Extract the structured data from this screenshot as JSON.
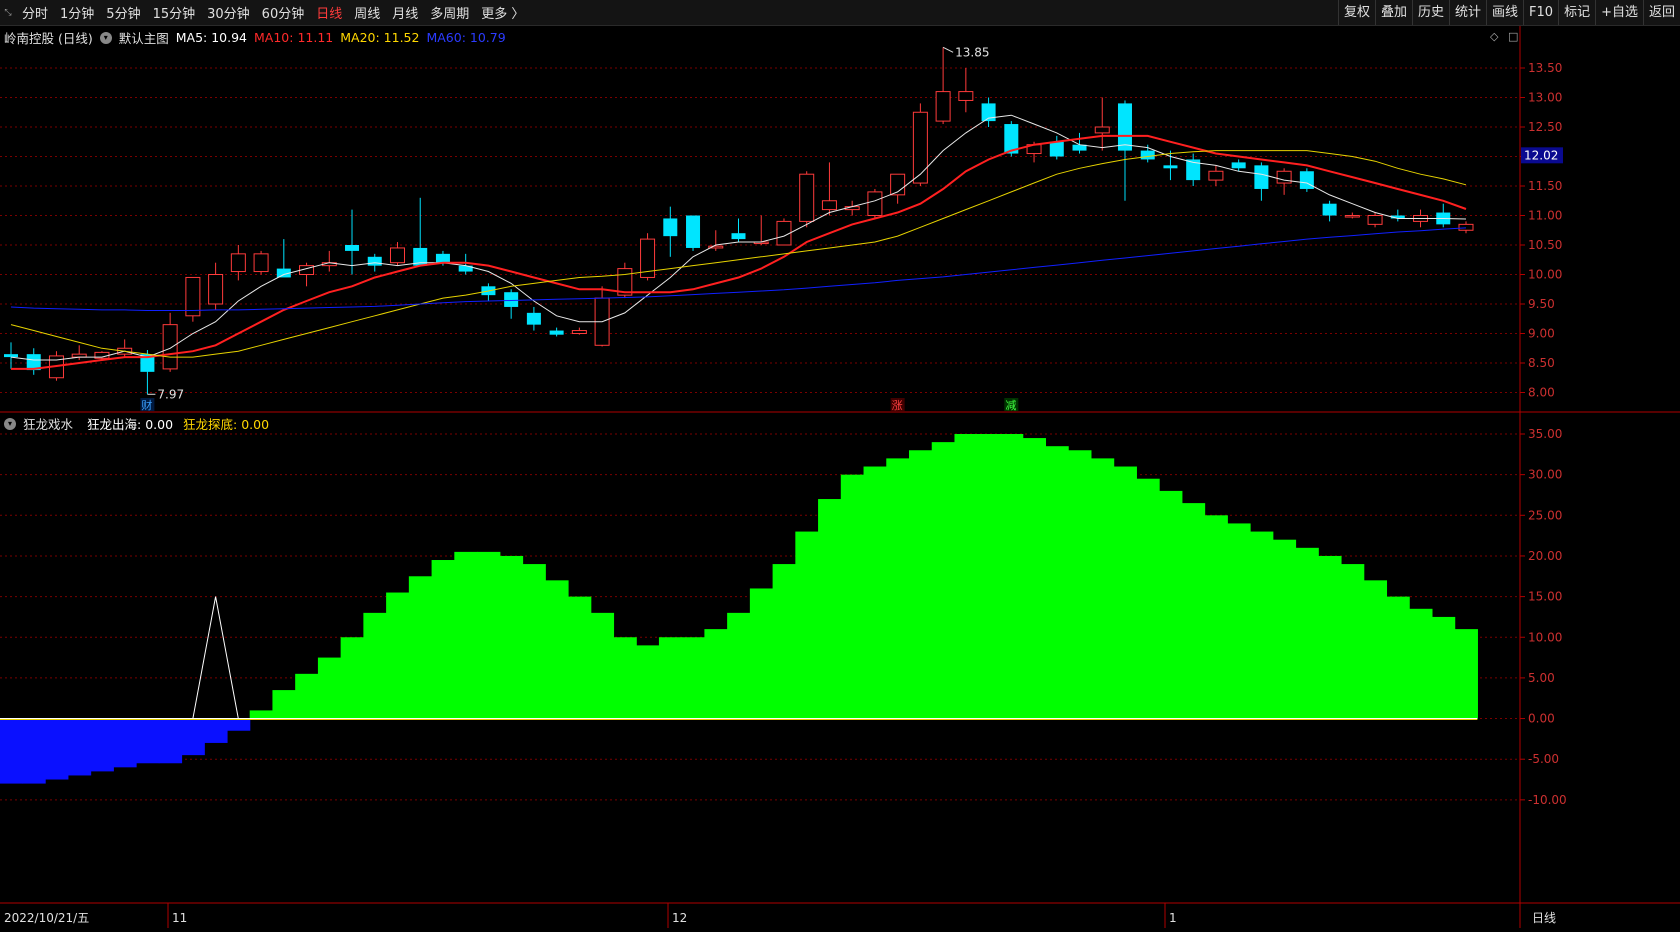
{
  "toolbar": {
    "periods": [
      {
        "label": "分时"
      },
      {
        "label": "1分钟"
      },
      {
        "label": "5分钟"
      },
      {
        "label": "15分钟"
      },
      {
        "label": "30分钟"
      },
      {
        "label": "60分钟"
      },
      {
        "label": "日线",
        "active": true
      },
      {
        "label": "周线"
      },
      {
        "label": "月线"
      },
      {
        "label": "多周期"
      },
      {
        "label": "更多 〉"
      }
    ],
    "actions": [
      "复权",
      "叠加",
      "历史",
      "统计",
      "画线",
      "F10",
      "标记",
      "+自选",
      "返回"
    ]
  },
  "main": {
    "stock_title": "岭南控股 (日线)",
    "template": "默认主图",
    "ma": [
      {
        "label": "MA5: 10.94",
        "color": "#ffffff"
      },
      {
        "label": "MA10: 11.11",
        "color": "#ff2a2a"
      },
      {
        "label": "MA20: 11.52",
        "color": "#ffd700"
      },
      {
        "label": "MA60: 10.79",
        "color": "#2b3bff"
      }
    ],
    "price_ticks": [
      "13.50",
      "13.00",
      "12.50",
      "12.00",
      "11.50",
      "11.00",
      "10.50",
      "10.00",
      "9.50",
      "9.00",
      "8.50",
      "8.00"
    ],
    "current_price": "12.02",
    "high_label": "13.85",
    "low_label": "7.97",
    "markers": [
      {
        "label": "财",
        "color": "#3aa0ff",
        "bg": "#001a40"
      },
      {
        "label": "涨",
        "color": "#ff4040",
        "bg": "#400000"
      },
      {
        "label": "减",
        "color": "#40ff40",
        "bg": "#003300"
      }
    ]
  },
  "indicator": {
    "name": "狂龙戏水",
    "items": [
      {
        "label": "狂龙出海: 0.00",
        "color": "#ffffff"
      },
      {
        "label": "狂龙探底: 0.00",
        "color": "#ffd700"
      }
    ],
    "ticks": [
      "35.00",
      "30.00",
      "25.00",
      "20.00",
      "15.00",
      "10.00",
      "5.00",
      "0.00",
      "-5.00",
      "-10.00"
    ]
  },
  "bottom_axis": {
    "date_label": "2022/10/21/五",
    "months": [
      "11",
      "12",
      "1"
    ],
    "period_label": "日线"
  },
  "colors": {
    "up": "#ff3b3b",
    "down": "#00e5ff",
    "green": "#00ff00",
    "blue": "#0a10ff",
    "grid": "#7a0000"
  },
  "chart_data": {
    "type": "candlestick",
    "candles": [
      {
        "o": 8.65,
        "h": 8.85,
        "l": 8.4,
        "c": 8.6
      },
      {
        "o": 8.65,
        "h": 8.75,
        "l": 8.3,
        "c": 8.38
      },
      {
        "o": 8.25,
        "h": 8.7,
        "l": 8.2,
        "c": 8.62
      },
      {
        "o": 8.6,
        "h": 8.8,
        "l": 8.55,
        "c": 8.65
      },
      {
        "o": 8.58,
        "h": 8.7,
        "l": 8.55,
        "c": 8.68
      },
      {
        "o": 8.65,
        "h": 8.9,
        "l": 8.6,
        "c": 8.75
      },
      {
        "o": 8.65,
        "h": 8.72,
        "l": 7.97,
        "c": 8.35
      },
      {
        "o": 8.4,
        "h": 9.35,
        "l": 8.35,
        "c": 9.15
      },
      {
        "o": 9.3,
        "h": 9.95,
        "l": 9.2,
        "c": 9.95
      },
      {
        "o": 9.5,
        "h": 10.2,
        "l": 9.4,
        "c": 10.0
      },
      {
        "o": 10.05,
        "h": 10.5,
        "l": 9.9,
        "c": 10.35
      },
      {
        "o": 10.05,
        "h": 10.4,
        "l": 10.0,
        "c": 10.35
      },
      {
        "o": 10.1,
        "h": 10.6,
        "l": 10.0,
        "c": 9.95
      },
      {
        "o": 10.0,
        "h": 10.2,
        "l": 9.8,
        "c": 10.15
      },
      {
        "o": 10.15,
        "h": 10.4,
        "l": 10.05,
        "c": 10.2
      },
      {
        "o": 10.5,
        "h": 11.1,
        "l": 10.0,
        "c": 10.4
      },
      {
        "o": 10.3,
        "h": 10.35,
        "l": 10.05,
        "c": 10.15
      },
      {
        "o": 10.2,
        "h": 10.55,
        "l": 10.15,
        "c": 10.45
      },
      {
        "o": 10.45,
        "h": 11.3,
        "l": 10.25,
        "c": 10.15
      },
      {
        "o": 10.35,
        "h": 10.4,
        "l": 10.15,
        "c": 10.2
      },
      {
        "o": 10.15,
        "h": 10.35,
        "l": 10.0,
        "c": 10.05
      },
      {
        "o": 9.8,
        "h": 9.85,
        "l": 9.55,
        "c": 9.65
      },
      {
        "o": 9.7,
        "h": 9.75,
        "l": 9.25,
        "c": 9.45
      },
      {
        "o": 9.35,
        "h": 9.45,
        "l": 9.05,
        "c": 9.15
      },
      {
        "o": 9.05,
        "h": 9.1,
        "l": 8.95,
        "c": 8.98
      },
      {
        "o": 9.0,
        "h": 9.1,
        "l": 8.98,
        "c": 9.05
      },
      {
        "o": 8.8,
        "h": 9.8,
        "l": 8.78,
        "c": 9.6
      },
      {
        "o": 9.65,
        "h": 10.2,
        "l": 9.6,
        "c": 10.1
      },
      {
        "o": 9.95,
        "h": 10.7,
        "l": 9.9,
        "c": 10.6
      },
      {
        "o": 10.95,
        "h": 11.15,
        "l": 10.3,
        "c": 10.65
      },
      {
        "o": 11.0,
        "h": 11.0,
        "l": 10.4,
        "c": 10.45
      },
      {
        "o": 10.45,
        "h": 10.75,
        "l": 10.4,
        "c": 10.48
      },
      {
        "o": 10.7,
        "h": 10.95,
        "l": 10.55,
        "c": 10.6
      },
      {
        "o": 10.55,
        "h": 11.0,
        "l": 10.5,
        "c": 10.55
      },
      {
        "o": 10.5,
        "h": 10.95,
        "l": 10.5,
        "c": 10.9
      },
      {
        "o": 10.9,
        "h": 11.75,
        "l": 10.8,
        "c": 11.7
      },
      {
        "o": 11.1,
        "h": 11.9,
        "l": 11.0,
        "c": 11.25
      },
      {
        "o": 11.1,
        "h": 11.25,
        "l": 11.0,
        "c": 11.15
      },
      {
        "o": 11.0,
        "h": 11.45,
        "l": 10.95,
        "c": 11.4
      },
      {
        "o": 11.35,
        "h": 11.6,
        "l": 11.2,
        "c": 11.7
      },
      {
        "o": 11.55,
        "h": 12.9,
        "l": 11.5,
        "c": 12.75
      },
      {
        "o": 12.6,
        "h": 13.85,
        "l": 12.55,
        "c": 13.1
      },
      {
        "o": 12.95,
        "h": 13.5,
        "l": 12.75,
        "c": 13.1
      },
      {
        "o": 12.9,
        "h": 13.0,
        "l": 12.5,
        "c": 12.6
      },
      {
        "o": 12.55,
        "h": 12.6,
        "l": 12.0,
        "c": 12.05
      },
      {
        "o": 12.05,
        "h": 12.25,
        "l": 11.9,
        "c": 12.2
      },
      {
        "o": 12.25,
        "h": 12.35,
        "l": 11.95,
        "c": 12.0
      },
      {
        "o": 12.2,
        "h": 12.4,
        "l": 12.05,
        "c": 12.1
      },
      {
        "o": 12.4,
        "h": 13.0,
        "l": 12.1,
        "c": 12.5
      },
      {
        "o": 12.9,
        "h": 12.95,
        "l": 11.25,
        "c": 12.1
      },
      {
        "o": 12.1,
        "h": 12.2,
        "l": 11.9,
        "c": 11.95
      },
      {
        "o": 11.85,
        "h": 12.1,
        "l": 11.6,
        "c": 11.8
      },
      {
        "o": 11.95,
        "h": 12.05,
        "l": 11.5,
        "c": 11.6
      },
      {
        "o": 11.6,
        "h": 11.85,
        "l": 11.5,
        "c": 11.75
      },
      {
        "o": 11.9,
        "h": 11.95,
        "l": 11.75,
        "c": 11.8
      },
      {
        "o": 11.85,
        "h": 11.9,
        "l": 11.25,
        "c": 11.45
      },
      {
        "o": 11.55,
        "h": 11.8,
        "l": 11.35,
        "c": 11.75
      },
      {
        "o": 11.75,
        "h": 11.8,
        "l": 11.4,
        "c": 11.45
      },
      {
        "o": 11.2,
        "h": 11.25,
        "l": 10.9,
        "c": 11.0
      },
      {
        "o": 11.0,
        "h": 11.05,
        "l": 10.95,
        "c": 11.0
      },
      {
        "o": 10.85,
        "h": 11.05,
        "l": 10.8,
        "c": 11.0
      },
      {
        "o": 11.0,
        "h": 11.1,
        "l": 10.9,
        "c": 10.95
      },
      {
        "o": 10.9,
        "h": 11.1,
        "l": 10.8,
        "c": 11.0
      },
      {
        "o": 11.05,
        "h": 11.2,
        "l": 10.8,
        "c": 10.85
      },
      {
        "o": 10.75,
        "h": 10.9,
        "l": 10.7,
        "c": 10.85
      }
    ],
    "ma_series": {
      "MA5": [
        8.6,
        8.55,
        8.55,
        8.6,
        8.6,
        8.7,
        8.6,
        8.75,
        9.0,
        9.2,
        9.55,
        9.8,
        10.0,
        10.1,
        10.2,
        10.15,
        10.2,
        10.15,
        10.2,
        10.2,
        10.15,
        10.05,
        9.85,
        9.55,
        9.3,
        9.2,
        9.2,
        9.35,
        9.65,
        9.95,
        10.3,
        10.5,
        10.55,
        10.55,
        10.65,
        10.85,
        11.05,
        11.15,
        11.25,
        11.4,
        11.7,
        12.1,
        12.4,
        12.65,
        12.7,
        12.55,
        12.4,
        12.2,
        12.15,
        12.2,
        12.15,
        12.0,
        11.9,
        11.85,
        11.75,
        11.7,
        11.6,
        11.55,
        11.35,
        11.2,
        11.05,
        10.95,
        10.95,
        10.95,
        10.94
      ],
      "MA10": [
        8.4,
        8.4,
        8.45,
        8.5,
        8.55,
        8.6,
        8.6,
        8.65,
        8.7,
        8.8,
        9.0,
        9.2,
        9.4,
        9.55,
        9.7,
        9.8,
        9.95,
        10.05,
        10.15,
        10.2,
        10.2,
        10.15,
        10.05,
        9.95,
        9.85,
        9.75,
        9.75,
        9.7,
        9.7,
        9.7,
        9.75,
        9.85,
        9.95,
        10.1,
        10.3,
        10.55,
        10.7,
        10.85,
        10.95,
        11.05,
        11.2,
        11.45,
        11.75,
        11.95,
        12.1,
        12.2,
        12.25,
        12.3,
        12.35,
        12.35,
        12.35,
        12.25,
        12.15,
        12.05,
        12.0,
        11.95,
        11.9,
        11.85,
        11.75,
        11.65,
        11.55,
        11.45,
        11.35,
        11.25,
        11.11
      ],
      "MA20": [
        9.15,
        9.05,
        8.95,
        8.85,
        8.75,
        8.7,
        8.65,
        8.6,
        8.6,
        8.65,
        8.7,
        8.8,
        8.9,
        9.0,
        9.1,
        9.2,
        9.3,
        9.4,
        9.5,
        9.6,
        9.65,
        9.72,
        9.8,
        9.85,
        9.9,
        9.95,
        9.97,
        10.0,
        10.05,
        10.1,
        10.15,
        10.2,
        10.25,
        10.3,
        10.35,
        10.4,
        10.45,
        10.5,
        10.55,
        10.65,
        10.8,
        10.95,
        11.1,
        11.25,
        11.4,
        11.55,
        11.7,
        11.8,
        11.88,
        11.95,
        12.0,
        12.05,
        12.08,
        12.1,
        12.1,
        12.1,
        12.1,
        12.1,
        12.05,
        12.0,
        11.92,
        11.8,
        11.7,
        11.62,
        11.52
      ],
      "MA60": [
        9.45,
        9.43,
        9.42,
        9.41,
        9.4,
        9.4,
        9.39,
        9.39,
        9.39,
        9.4,
        9.4,
        9.41,
        9.42,
        9.43,
        9.44,
        9.45,
        9.46,
        9.48,
        9.5,
        9.52,
        9.54,
        9.55,
        9.56,
        9.57,
        9.58,
        9.59,
        9.6,
        9.61,
        9.62,
        9.64,
        9.66,
        9.68,
        9.7,
        9.72,
        9.74,
        9.77,
        9.8,
        9.83,
        9.86,
        9.9,
        9.93,
        9.96,
        10.0,
        10.04,
        10.08,
        10.12,
        10.16,
        10.2,
        10.24,
        10.28,
        10.32,
        10.36,
        10.4,
        10.44,
        10.48,
        10.52,
        10.56,
        10.6,
        10.63,
        10.66,
        10.69,
        10.72,
        10.74,
        10.77,
        10.79
      ]
    },
    "kuanglong_bars": [
      -8,
      -8,
      -7.5,
      -7,
      -6.5,
      -6,
      -5.5,
      -5.5,
      -4.5,
      -3,
      -1.5,
      1,
      3.5,
      5.5,
      7.5,
      10,
      13,
      15.5,
      17.5,
      19.5,
      20.5,
      20.5,
      20,
      19,
      17,
      15,
      13,
      10,
      9,
      10,
      10,
      11,
      13,
      16,
      19,
      23,
      27,
      30,
      31,
      32,
      33,
      34,
      35,
      35,
      35,
      34.5,
      33.5,
      33,
      32,
      31,
      29.5,
      28,
      26.5,
      25,
      24,
      23,
      22,
      21,
      20,
      19,
      17,
      15,
      13.5,
      12.5,
      11
    ],
    "kuanglong_chuhai": [
      0,
      0,
      0,
      0,
      0,
      0,
      0,
      0,
      0,
      15,
      0,
      0,
      0,
      0,
      0,
      0,
      0,
      0,
      0,
      0,
      0,
      0,
      0,
      0,
      0,
      0,
      0,
      0,
      0,
      0,
      0,
      0,
      0,
      0,
      0,
      0,
      0,
      0,
      0,
      0,
      0,
      0,
      0,
      0,
      0,
      0,
      0,
      0,
      0,
      0,
      0,
      0,
      0,
      0,
      0,
      0,
      0,
      0,
      0,
      0,
      0,
      0,
      0,
      0,
      0
    ]
  }
}
